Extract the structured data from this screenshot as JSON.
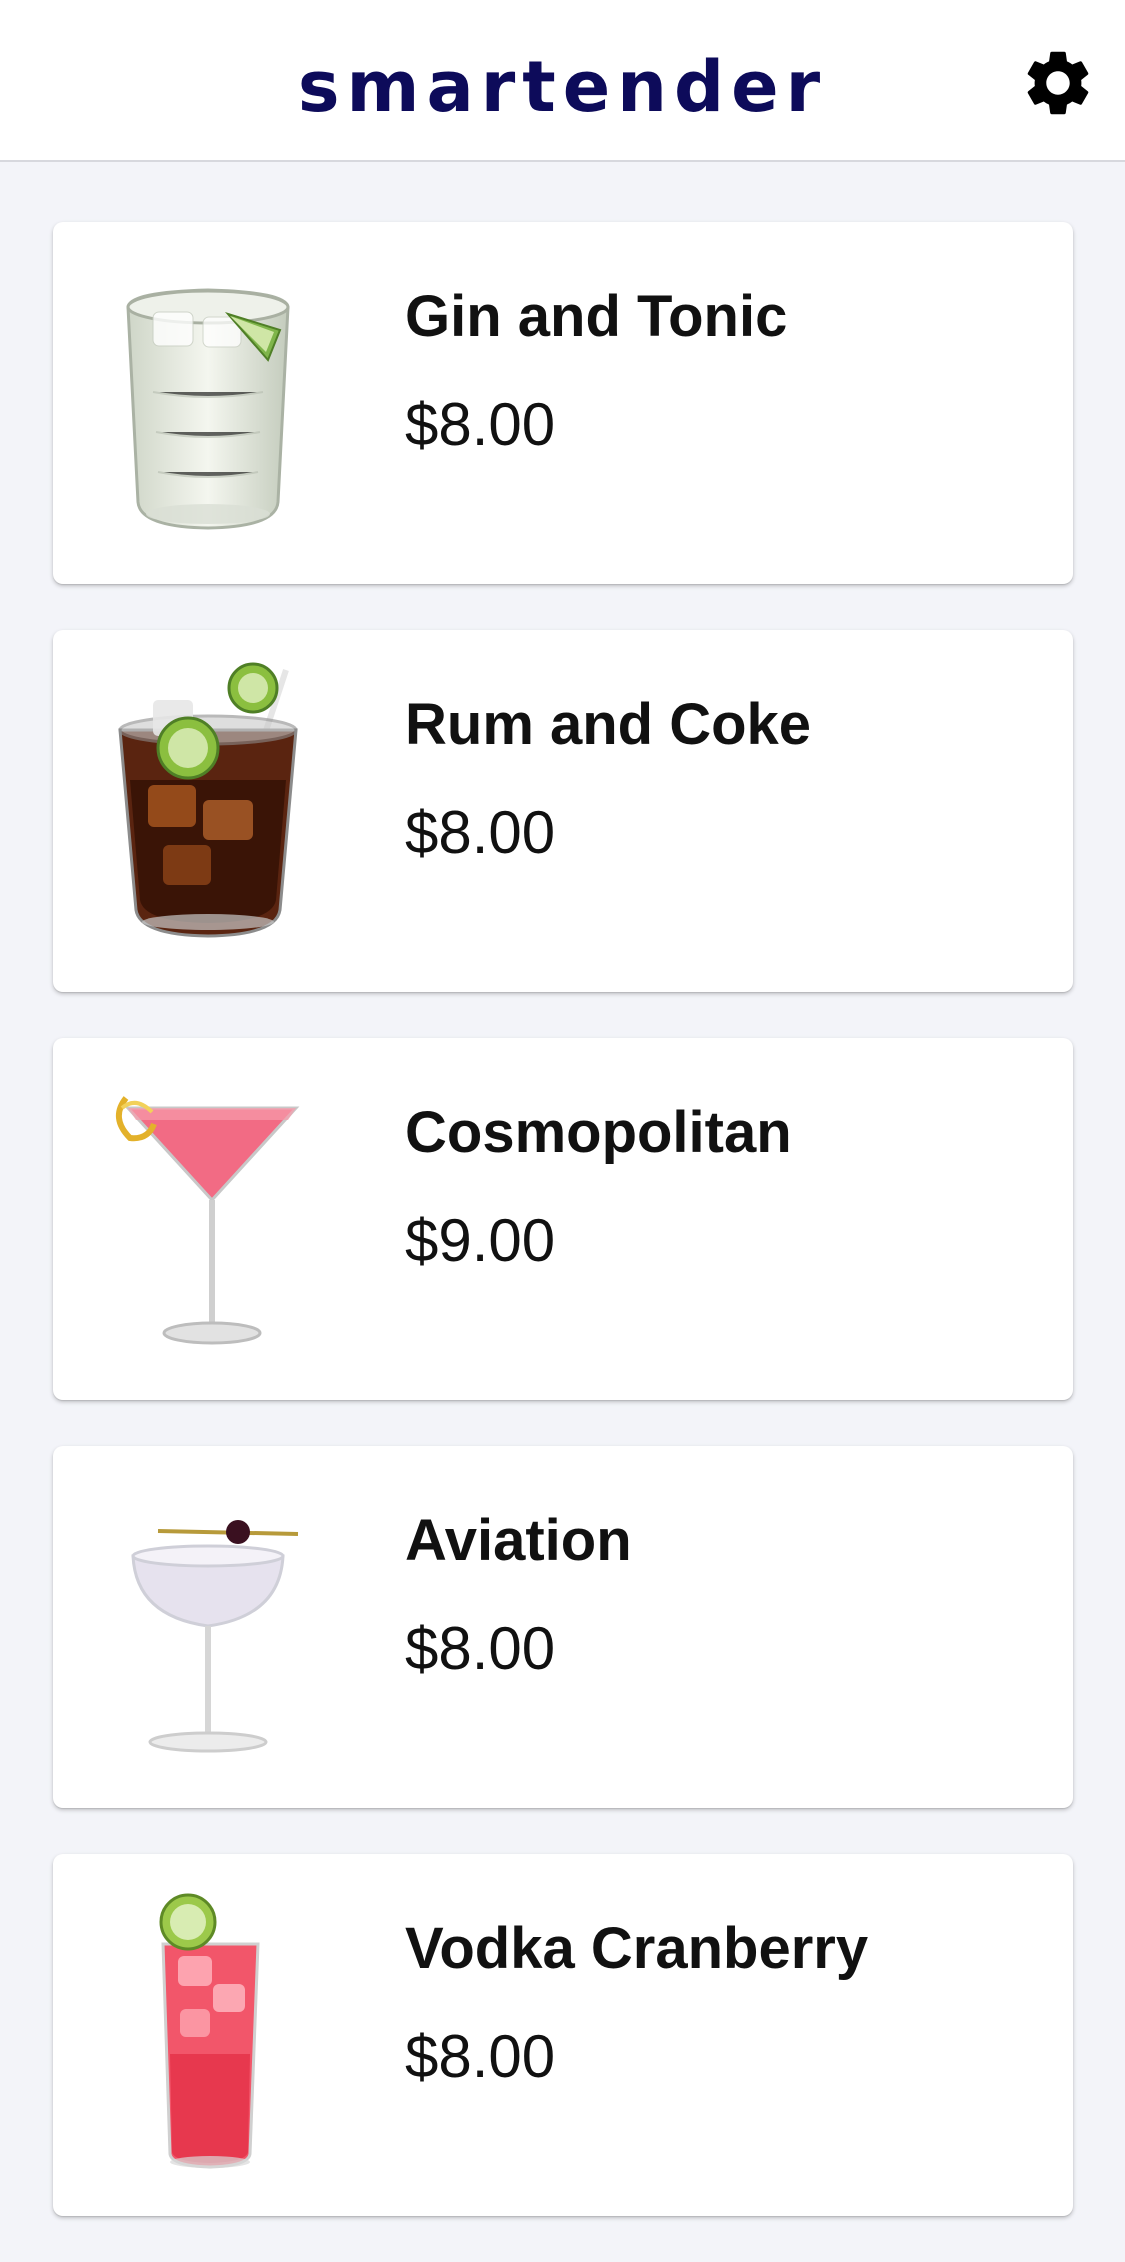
{
  "header": {
    "brand": "smartender",
    "settings_icon": "gear-icon"
  },
  "drinks": [
    {
      "name": "Gin and Tonic",
      "price": "$8.00",
      "image_icon": "gin-and-tonic-glass-icon"
    },
    {
      "name": "Rum and Coke",
      "price": "$8.00",
      "image_icon": "rum-and-coke-glass-icon"
    },
    {
      "name": "Cosmopolitan",
      "price": "$9.00",
      "image_icon": "cosmopolitan-glass-icon"
    },
    {
      "name": "Aviation",
      "price": "$8.00",
      "image_icon": "aviation-glass-icon"
    },
    {
      "name": "Vodka Cranberry",
      "price": "$8.00",
      "image_icon": "vodka-cranberry-glass-icon"
    }
  ],
  "colors": {
    "brand": "#0d0b5a",
    "background": "#f3f4f9",
    "card": "#ffffff"
  }
}
